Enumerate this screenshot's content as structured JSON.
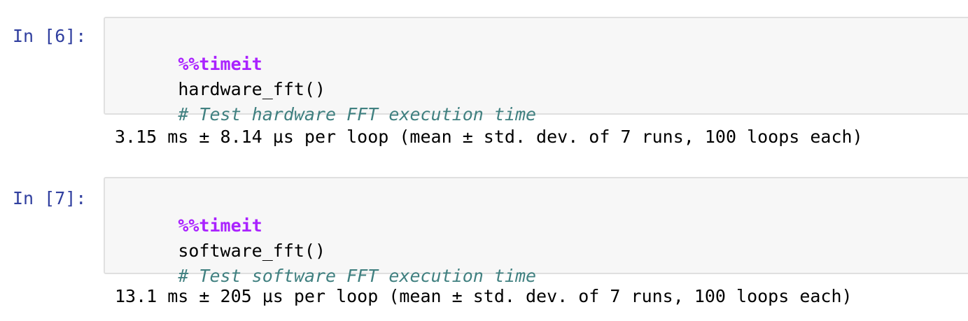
{
  "cells": [
    {
      "prompt": "In [6]:",
      "code": {
        "magic": "%%timeit",
        "call": "hardware_fft()",
        "comment": "# Test hardware FFT execution time"
      },
      "output": "3.15 ms ± 8.14 µs per loop (mean ± std. dev. of 7 runs, 100 loops each)"
    },
    {
      "prompt": "In [7]:",
      "code": {
        "magic": "%%timeit",
        "call": "software_fft()",
        "comment": "# Test software FFT execution time"
      },
      "output": "13.1 ms ± 205 µs per loop (mean ± std. dev. of 7 runs, 100 loops each)"
    }
  ],
  "colors": {
    "prompt": "#303F9F",
    "magic": "#AA22FF",
    "comment": "#408080",
    "input_background": "#f7f7f7",
    "input_border": "#e0e0e0"
  }
}
